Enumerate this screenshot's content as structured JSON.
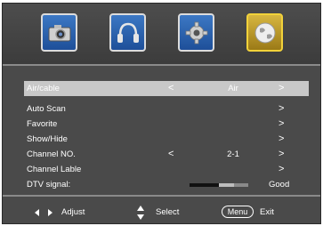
{
  "tabs": [
    {
      "name": "picture",
      "active": false
    },
    {
      "name": "sound",
      "active": false
    },
    {
      "name": "setup",
      "active": false
    },
    {
      "name": "channel",
      "active": true
    }
  ],
  "menu": {
    "air_cable": {
      "label": "Air/cable",
      "value": "Air",
      "left_arrow": "<",
      "right_arrow": ">"
    },
    "auto_scan": {
      "label": "Auto  Scan",
      "right_arrow": ">"
    },
    "favorite": {
      "label": "Favorite",
      "right_arrow": ">"
    },
    "show_hide": {
      "label": "Show/Hide",
      "right_arrow": ">"
    },
    "channel_no": {
      "label": "Channel NO.",
      "value": "2-1",
      "left_arrow": "<",
      "right_arrow": ">"
    },
    "channel_lable": {
      "label": "Channel Lable",
      "right_arrow": ">"
    },
    "dtv_signal": {
      "label": "DTV signal:",
      "status": "Good",
      "level": 0.5
    }
  },
  "footer": {
    "adjust_label": "Adjust",
    "select_label": "Select",
    "menu_key": "Menu",
    "exit_label": "Exit"
  },
  "colors": {
    "panel": "#4a4a4a",
    "selected_row": "#c8c8c8",
    "tab_blue": "#2a5fae",
    "tab_active_gold": "#c9a02e"
  }
}
